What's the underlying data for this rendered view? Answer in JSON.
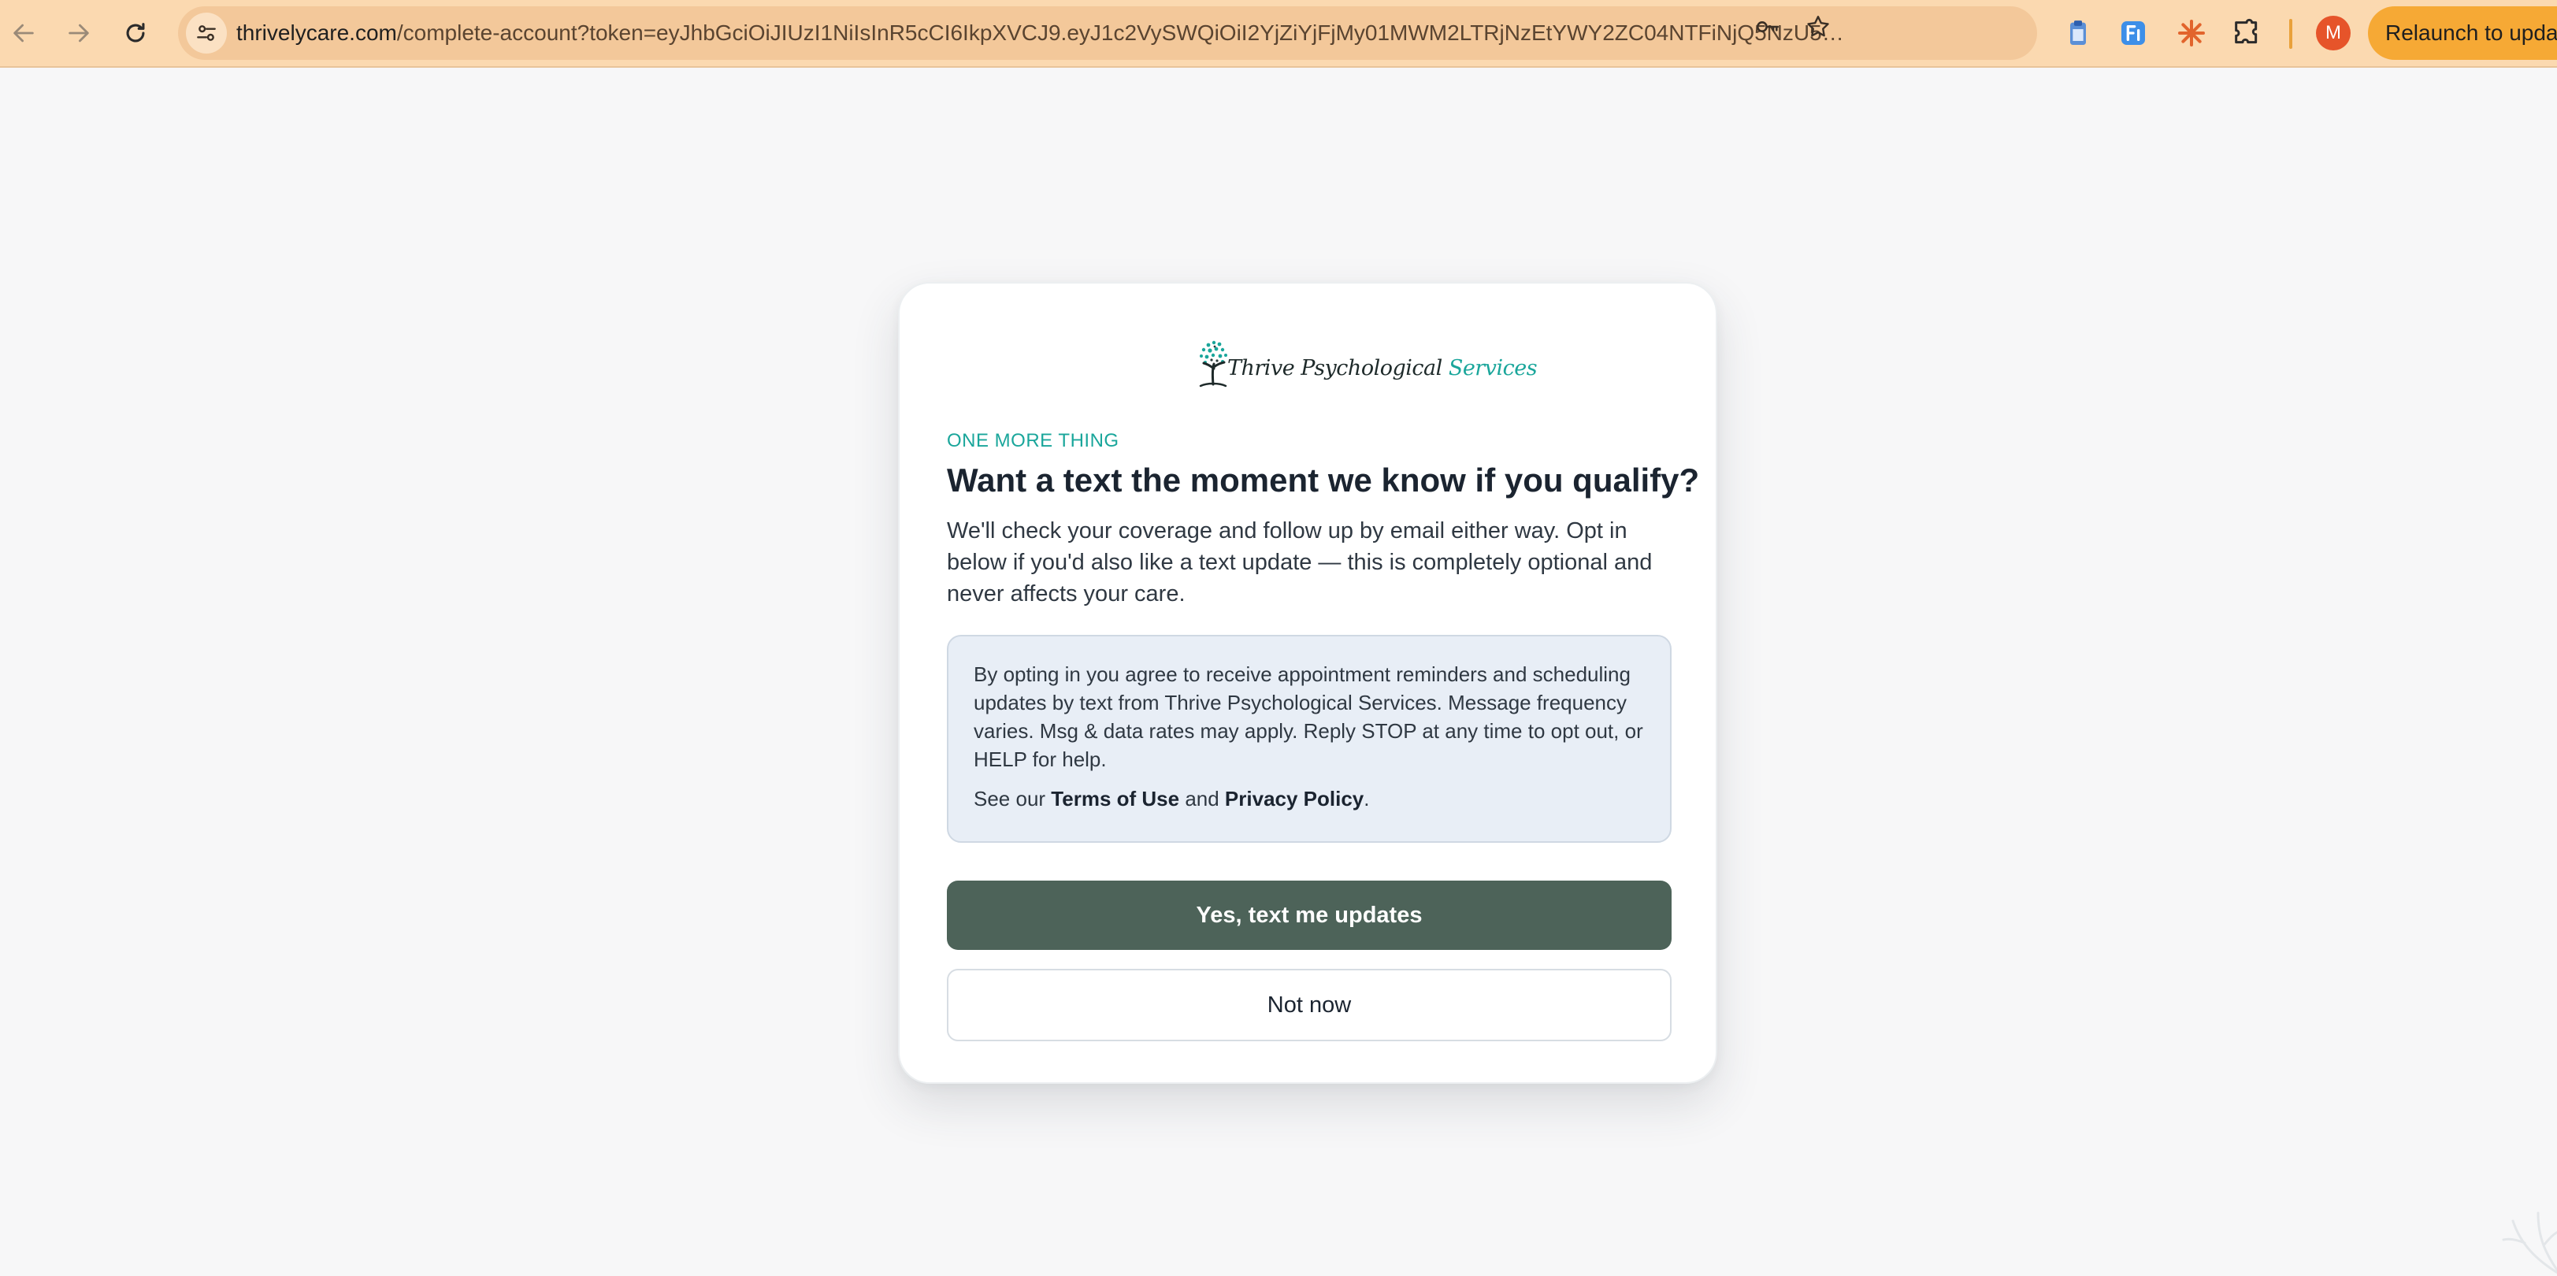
{
  "browser": {
    "url_host": "thrivelycare.com",
    "url_path": "/complete-account?token=eyJhbGciOiJIUzI1NiIsInR5cCI6IkpXVCJ9.eyJ1c2VySWQiOiI2YjZiYjFjMy01MWM2LTRjNzEtYWY2ZC04NTFiNjQ5NzU5…",
    "avatar_initial": "M",
    "relaunch_label": "Relaunch to update",
    "colors": {
      "toolbar": "#fbd9b0",
      "omnibox": "#f3c89a",
      "relaunch": "#f6a935"
    }
  },
  "icons": {
    "back": "back-arrow-icon",
    "forward": "forward-arrow-icon",
    "reload": "reload-icon",
    "site_info": "tune-icon",
    "password": "key-icon",
    "bookmark": "star-icon",
    "extensions": [
      "clipboard-extension-icon",
      "fi-extension-icon",
      "asterisk-extension-icon",
      "puzzle-icon"
    ]
  },
  "card": {
    "logo": {
      "part1": "Thrive Psychological ",
      "part2": "Services"
    },
    "eyebrow": "ONE MORE THING",
    "headline": "Want a text the moment we know if you qualify?",
    "lead": "We'll check your coverage and follow up by email either way. Opt in below if you'd also like a text update — this is completely optional and never affects your care.",
    "consent": {
      "text": "By opting in you agree to receive appointment reminders and scheduling updates by text from Thrive Psychological Services. Message frequency varies. Msg & data rates may apply. Reply STOP at any time to opt out, or HELP for help.",
      "links_prefix": "See our ",
      "terms_label": "Terms of Use",
      "and": " and ",
      "privacy_label": "Privacy Policy",
      "suffix": "."
    },
    "primary_button": "Yes, text me updates",
    "secondary_button": "Not now",
    "colors": {
      "accent": "#1aa69b",
      "primary_button": "#4d6359",
      "consent_bg": "#e8eef6"
    }
  }
}
